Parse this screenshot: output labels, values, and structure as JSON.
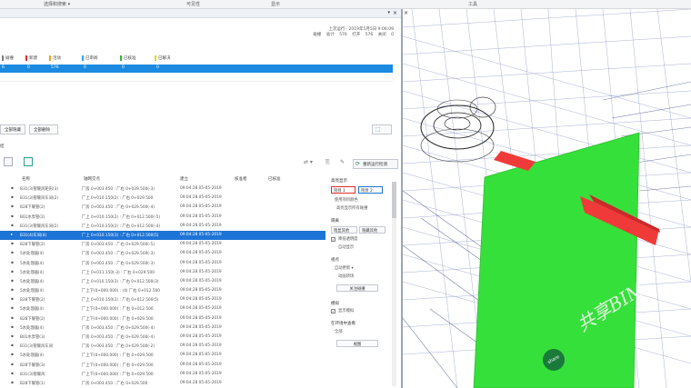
{
  "ribbon": {
    "items": [
      "选择和搜索 ▾",
      "可见性",
      "显示",
      "工具"
    ]
  },
  "summary": {
    "line1": "上次运行 · 2019年5月5日 9:06:09",
    "line2_labels": [
      "碰撞",
      "总计",
      "576",
      "打开",
      "576",
      "关闭",
      "0"
    ]
  },
  "status": {
    "headers": [
      {
        "label": "碰撞",
        "color": "#7f7f7f"
      },
      {
        "label": "新建",
        "color": "#e02b2b"
      },
      {
        "label": "活动",
        "color": "#f0a01a"
      },
      {
        "label": "已审阅",
        "color": "#2aa6e8"
      },
      {
        "label": "已核准",
        "color": "#33b533"
      },
      {
        "label": "已解决",
        "color": "#e6d21a"
      }
    ],
    "values": [
      "6",
      "0",
      "576",
      "0",
      "0",
      "0"
    ]
  },
  "buttons": {
    "show_all": "全部隐藏",
    "remove_all": "全部删除"
  },
  "section_label": "结",
  "refresh_label": "重新运行检测",
  "table": {
    "columns": [
      "名称",
      "轴网交点",
      "建立",
      "核准者",
      "已核准"
    ],
    "rows": [
      {
        "name": "B31(3)管暖风矩形(3)",
        "grid": "厂房 0+003.450 : 厂右 0+029.500(-3)",
        "date": "09:04:28 05-05-2019"
      },
      {
        "name": "B31(3)管暖风车间(2)",
        "grid": "厂上 0+010.150(2) : 厂右 0+029.500",
        "date": "09:04:28 05-05-2019"
      },
      {
        "name": "B28下暖管(2)",
        "grid": "厂房 0+003.450 : 厂右 0+029.500(-4)",
        "date": "09:04:28 05-05-2019"
      },
      {
        "name": "B01水泵管(2)",
        "grid": "厂上 0+010.150(2) : 厂右 0+012.500(-5)",
        "date": "09:04:28 05-05-2019"
      },
      {
        "name": "B31(3)管暖风车间(2)",
        "grid": "厂上 0+010.150(2) : 厂右 0+012.500(-4)",
        "date": "09:04:28 05-05-2019"
      },
      {
        "name": "B31(4)车间(4)",
        "grid": "厂上 0+010.150(3) : 厂右 0+012.500(5)",
        "date": "09:04:28 05-05-2019",
        "selected": true
      },
      {
        "name": "B28下暖管(2)",
        "grid": "厂房 0+003.450 : 厂右 0+029.500(-5)",
        "date": "09:04:28 05-05-2019"
      },
      {
        "name": "5水处理器(4)",
        "grid": "厂房 0+003.450 : 厂右 0+029.500(-3)",
        "date": "09:04:28 05-05-2019"
      },
      {
        "name": "5水处理器(4)",
        "grid": "厂房 0+003.450 : 厂右 0+029.500(-3)",
        "date": "09:04:28 05-05-2019"
      },
      {
        "name": "5水处理器(4)",
        "grid": "厂上 0+011.150(-3) : 厂右 0+029.500",
        "date": "09:04:28 05-05-2019"
      },
      {
        "name": "5水处理器(4)",
        "grid": "厂上 0+010.150(3) : 厂右 0+012.500(3)",
        "date": "09:04:28 05-05-2019"
      },
      {
        "name": "5水处理器(4)",
        "grid": "厂上下(0+000.000) : (4) 厂右 0+012.500",
        "date": "09:04:28 05-05-2019"
      },
      {
        "name": "B28下暖管(2)",
        "grid": "厂上 0+010.150(2) : 厂右 0+012.500(5)",
        "date": "09:04:28 05-05-2019"
      },
      {
        "name": "5水处理器(4)",
        "grid": "厂上下(0+000.000) : 厂右 0+012.500",
        "date": "09:04:28 05-05-2019"
      },
      {
        "name": "B28下暖管(2)",
        "grid": "厂上下(0+000.000) : 厂右 0+029.500",
        "date": "09:04:28 05-05-2019"
      },
      {
        "name": "5水处理器(4)",
        "grid": "厂房 0+003.450 : 厂右 0+029.500(-4)",
        "date": "09:04:28 05-05-2019"
      },
      {
        "name": "B01水泵管(3)",
        "grid": "厂房 0+003.450 : 厂右 0+029.500(-4)",
        "date": "09:04:28 05-05-2019"
      },
      {
        "name": "B31(3)管暖风车间",
        "grid": "厂房 0+003.450 : 厂右 0+029.500(-2)",
        "date": "09:04:28 05-05-2019"
      },
      {
        "name": "5水处理器(4)",
        "grid": "厂上下(0+000.000) : 厂右 0+029.500",
        "date": "09:04:28 05-05-2019"
      },
      {
        "name": "B28下暖管(3)",
        "grid": "厂上下(0+000.000) : 厂右 0+029.500",
        "date": "09:04:28 05-05-2019"
      },
      {
        "name": "B31(3)管暖风",
        "grid": "厂上下(0+000.000) : 厂右 0+029.500",
        "date": "09:04:28 05-05-2019"
      },
      {
        "name": "B28下暖管(1)",
        "grid": "厂房 0+003.450 : 厂右 0+029.500",
        "date": "09:04:28 05-05-2019"
      }
    ]
  },
  "right_col": {
    "highlight_label": "高亮显示",
    "item1": "项目 1",
    "item2": "项目 2",
    "use_item_color": "使用项目颜色",
    "highlight_all": "高亮显示所有碰撞",
    "isolate_label": "隔离",
    "dim_others": "暗显其他",
    "hide_others": "隐藏其他",
    "lower_transparency": "降低透明度",
    "auto_reveal": "自动显示",
    "viewpoint_label": "视点",
    "auto_update": "自动更新 ▾",
    "animate": "动画转场",
    "focus_clash": "关注碰撞",
    "simulation_label": "模拟",
    "show_sim": "显示模拟",
    "env_label": "在环境中查看",
    "env_value": "全部",
    "view_btn": "视图"
  },
  "watermark": {
    "circle": "share",
    "text": "共享BIM"
  },
  "colors": {
    "selection_blue": "#1e73d6",
    "status_bar_blue": "#1b8ae0",
    "clash_green": "#36e03a",
    "clash_red": "#f03a3a"
  }
}
